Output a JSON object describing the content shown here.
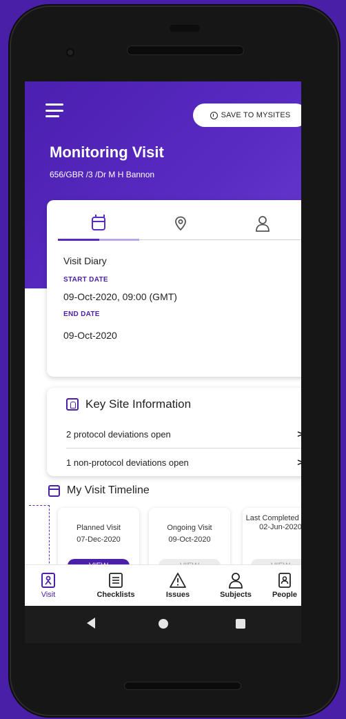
{
  "header": {
    "save_label": "SAVE TO MYSITES",
    "title": "Monitoring Visit",
    "subtitle": "656/GBR /3 /Dr M H Bannon"
  },
  "visit_card": {
    "tabs": [
      {
        "icon": "calendar-icon",
        "active": true
      },
      {
        "icon": "location-pin-icon",
        "active": false
      },
      {
        "icon": "person-icon",
        "active": false
      }
    ],
    "heading": "Visit Diary",
    "start_label": "START DATE",
    "start_value": "09-Oct-2020, 09:00 (GMT)",
    "end_label": "END DATE",
    "end_value": "09-Oct-2020"
  },
  "key_site": {
    "title": "Key Site Information",
    "rows": [
      {
        "text": "2 protocol deviations open",
        "chevron": ">"
      },
      {
        "text": "1 non-protocol deviations open",
        "chevron": ">"
      }
    ]
  },
  "timeline": {
    "title": "My Visit Timeline",
    "cards": [
      {
        "name": "Planned Visit",
        "date": "07-Dec-2020",
        "action": "VIEW",
        "active": true
      },
      {
        "name": "Ongoing Visit",
        "date": "09-Oct-2020",
        "action": "VIEW",
        "active": false
      },
      {
        "name": "Last Completed Visit",
        "date": "02-Jun-2020",
        "action": "VIEW",
        "active": false
      }
    ]
  },
  "bottom_nav": [
    {
      "label": "Visit",
      "icon": "visit-icon",
      "active": true
    },
    {
      "label": "Checklists",
      "icon": "checklist-icon",
      "active": false
    },
    {
      "label": "Issues",
      "icon": "warning-icon",
      "active": false
    },
    {
      "label": "Subjects",
      "icon": "person-icon",
      "active": false
    },
    {
      "label": "People",
      "icon": "contacts-icon",
      "active": false
    }
  ],
  "colors": {
    "brand": "#4b1fa8",
    "background": "#4a1fa8"
  }
}
